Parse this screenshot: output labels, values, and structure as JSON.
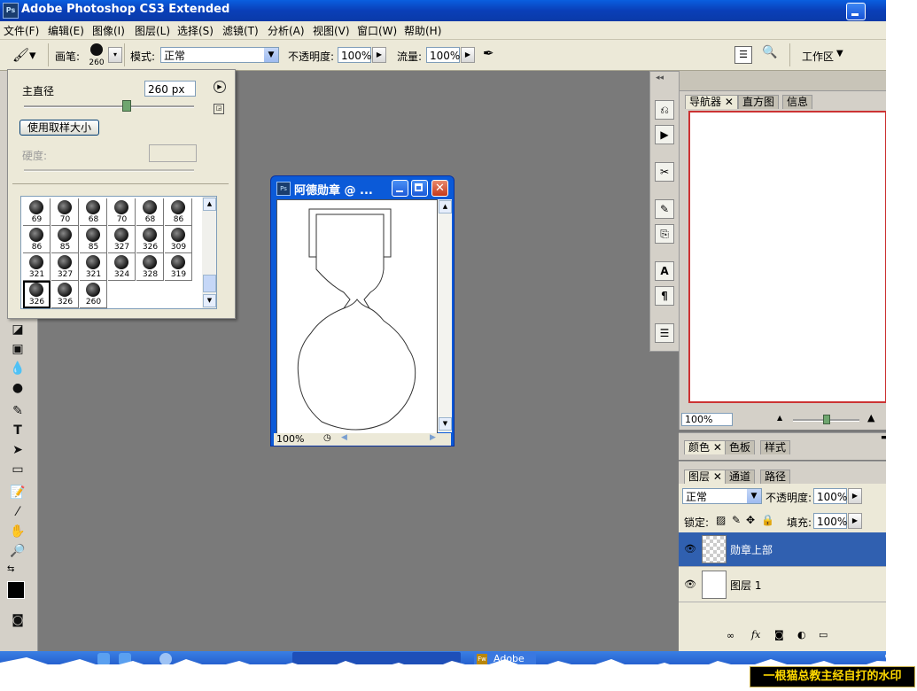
{
  "window": {
    "title": "Adobe Photoshop CS3 Extended",
    "app_badge": "Ps"
  },
  "menu": [
    "文件(F)",
    "编辑(E)",
    "图像(I)",
    "图层(L)",
    "选择(S)",
    "滤镜(T)",
    "分析(A)",
    "视图(V)",
    "窗口(W)",
    "帮助(H)"
  ],
  "options_bar": {
    "brush_label": "画笔:",
    "brush_size_badge": "260",
    "mode_label": "模式:",
    "mode_value": "正常",
    "opacity_label": "不透明度:",
    "opacity_value": "100%",
    "flow_label": "流量:",
    "flow_value": "100%",
    "workspace_label": "工作区"
  },
  "brush_panel": {
    "diameter_label": "主直径",
    "diameter_value": "260 px",
    "diameter_fraction": 0.6,
    "use_sample_size": "使用取样大小",
    "hardness_label": "硬度:",
    "brushes": [
      [
        "69",
        "70",
        "68",
        "70",
        "68",
        "86"
      ],
      [
        "86",
        "85",
        "85",
        "327",
        "326",
        "309"
      ],
      [
        "321",
        "327",
        "321",
        "324",
        "328",
        "319"
      ],
      [
        "326",
        "326",
        "260"
      ]
    ],
    "selected_brush": "326"
  },
  "document": {
    "title": "阿德勋章 @ ...",
    "app_badge": "Ps",
    "zoom": "100%"
  },
  "navigator": {
    "tabs": [
      "导航器",
      "直方图",
      "信息"
    ],
    "zoom": "100%"
  },
  "color_panel": {
    "tabs": [
      "颜色",
      "色板",
      "样式"
    ]
  },
  "layers_panel": {
    "tabs": [
      "图层",
      "通道",
      "路径"
    ],
    "blend_mode": "正常",
    "opacity_label": "不透明度:",
    "opacity_value": "100%",
    "lock_label": "锁定:",
    "fill_label": "填充:",
    "fill_value": "100%",
    "layers": [
      {
        "name": "勋章上部",
        "selected": true
      },
      {
        "name": "图层 1",
        "selected": false
      }
    ]
  },
  "taskbar": {
    "items": [
      "Adobe"
    ]
  },
  "watermark": "一根猫总教主经自打的水印"
}
